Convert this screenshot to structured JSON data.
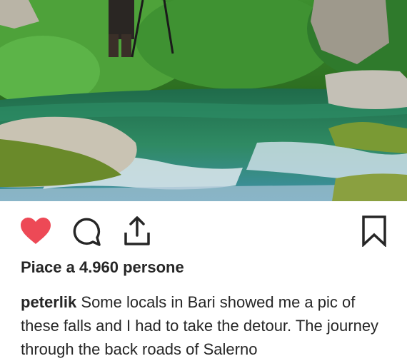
{
  "post": {
    "image_description_icon": "river-photo",
    "actions": {
      "like_icon": "heart-filled-icon",
      "comment_icon": "comment-icon",
      "share_icon": "share-icon",
      "save_icon": "bookmark-icon",
      "like_color": "#ed4956"
    },
    "likes_text": "Piace a 4.960 persone",
    "caption": {
      "username": "peterlik",
      "text": "Some locals in Bari showed me a pic of these falls and I had to take the detour. The journey through the back roads of Salerno"
    }
  }
}
